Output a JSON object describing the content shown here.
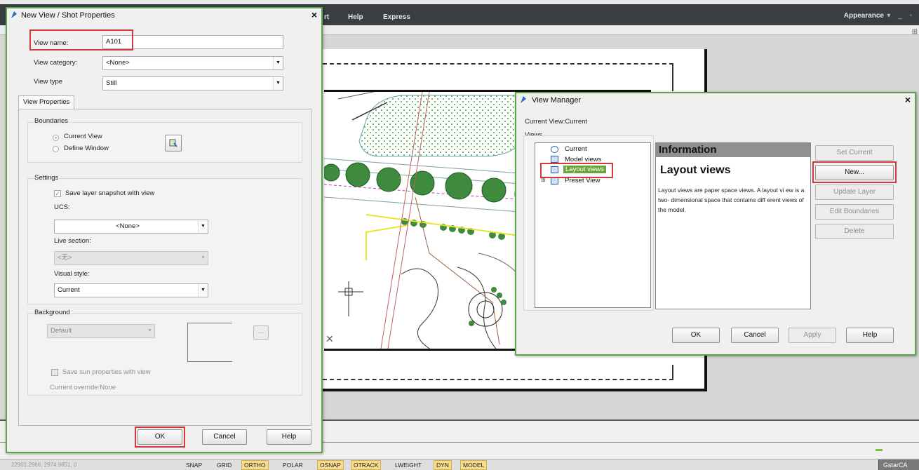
{
  "app": {
    "menu": [
      "rt",
      "Help",
      "Express"
    ],
    "appearance": "Appearance",
    "window_controls": "▾ _ ▫",
    "ribbon_end": "⊞"
  },
  "status_bar": {
    "coords": "22901.2966, 2974.9851, 0",
    "toggles": [
      {
        "label": "SNAP",
        "on": false
      },
      {
        "label": "GRID",
        "on": false
      },
      {
        "label": "ORTHO",
        "on": true
      },
      {
        "label": "POLAR",
        "on": false
      },
      {
        "label": "OSNAP",
        "on": true
      },
      {
        "label": "OTRACK",
        "on": true
      },
      {
        "label": "LWEIGHT",
        "on": false
      },
      {
        "label": "DYN",
        "on": true
      },
      {
        "label": "MODEL",
        "on": true
      }
    ],
    "brand": "GstarCA"
  },
  "new_view_dialog": {
    "title": "New View / Shot Properties",
    "close": "×",
    "view_name_label": "View name:",
    "view_name_value": "A101",
    "view_category_label": "View category:",
    "view_category_value": "<None>",
    "view_type_label": "View type",
    "view_type_value": "Still",
    "tab": "View Properties",
    "boundaries": {
      "title": "Boundaries",
      "current_view": "Current View",
      "define_window": "Define Window"
    },
    "settings": {
      "title": "Settings",
      "save_layer_snapshot": "Save layer snapshot with view",
      "ucs_label": "UCS:",
      "ucs_value": "<None>",
      "live_section_label": "Live section:",
      "live_section_value": "<无>",
      "visual_style_label": "Visual style:",
      "visual_style_value": "Current"
    },
    "background": {
      "title": "Background",
      "value": "Default",
      "browse": "...",
      "save_sun": "Save sun properties with view",
      "current_override": "Current override:None"
    },
    "ok": "OK",
    "cancel": "Cancel",
    "help": "Help"
  },
  "view_manager": {
    "title": "View Manager",
    "close": "×",
    "current_view": "Current View:Current",
    "views_label": "Views",
    "tree": [
      {
        "label": "Current",
        "selected": false
      },
      {
        "label": "Model views",
        "selected": false
      },
      {
        "label": "Layout views",
        "selected": true
      },
      {
        "label": "Preset View",
        "selected": false
      }
    ],
    "info_header": "Information",
    "info_title": "Layout views",
    "info_text": "Layout views are paper space views. A layout vi ew is a two- dimensional space that contains diff erent views of the model.",
    "buttons": {
      "set_current": "Set Current",
      "new": "New...",
      "update_layer": "Update Layer",
      "edit_boundaries": "Edit Boundaries",
      "delete": "Delete"
    },
    "ok": "OK",
    "cancel": "Cancel",
    "apply": "Apply",
    "help": "Help"
  },
  "colors": {
    "dialog_border": "#5aa54a",
    "highlight": "#d23a3a",
    "tree_selected": "#6aa63a",
    "status_on": "#f6dc8c"
  }
}
